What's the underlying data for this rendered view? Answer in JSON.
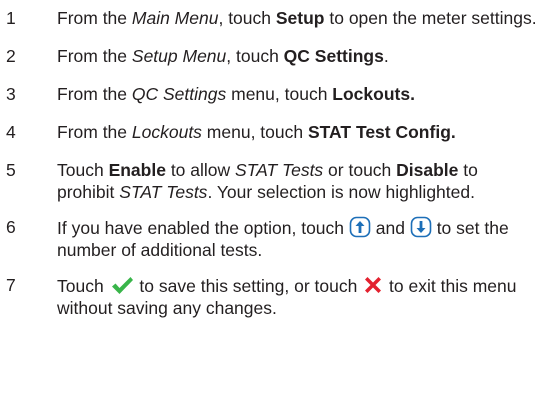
{
  "steps": [
    {
      "number": "1",
      "parts": [
        "From the ",
        "Main Menu",
        ", touch ",
        "Setup",
        " to open the meter settings."
      ]
    },
    {
      "number": "2",
      "parts": [
        "From the ",
        "Setup Menu",
        ", touch ",
        "QC Settings",
        "."
      ]
    },
    {
      "number": "3",
      "parts": [
        "From the ",
        "QC Settings",
        " menu, touch ",
        "Lockouts."
      ]
    },
    {
      "number": "4",
      "parts": [
        "From the ",
        "Lockouts",
        " menu, touch ",
        "STAT Test Config."
      ]
    },
    {
      "number": "5",
      "parts": [
        "Touch ",
        "Enable",
        " to allow ",
        "STAT Tests",
        " or touch ",
        "Disable",
        " to prohibit ",
        "STAT Tests",
        ". Your selection is now highlighted."
      ]
    },
    {
      "number": "6",
      "parts": [
        "If you have enabled the option, touch ",
        " and ",
        " to set the number of additional tests."
      ]
    },
    {
      "number": "7",
      "parts": [
        "Touch ",
        " to save this setting, or touch ",
        " to exit this menu without saving any changes."
      ]
    }
  ],
  "icons": {
    "up": "up-arrow-icon",
    "down": "down-arrow-icon",
    "confirm": "checkmark-icon",
    "cancel": "x-icon"
  },
  "colors": {
    "arrow_blue": "#1d6fb8",
    "check_green": "#39b54a",
    "x_red": "#e3212f"
  }
}
